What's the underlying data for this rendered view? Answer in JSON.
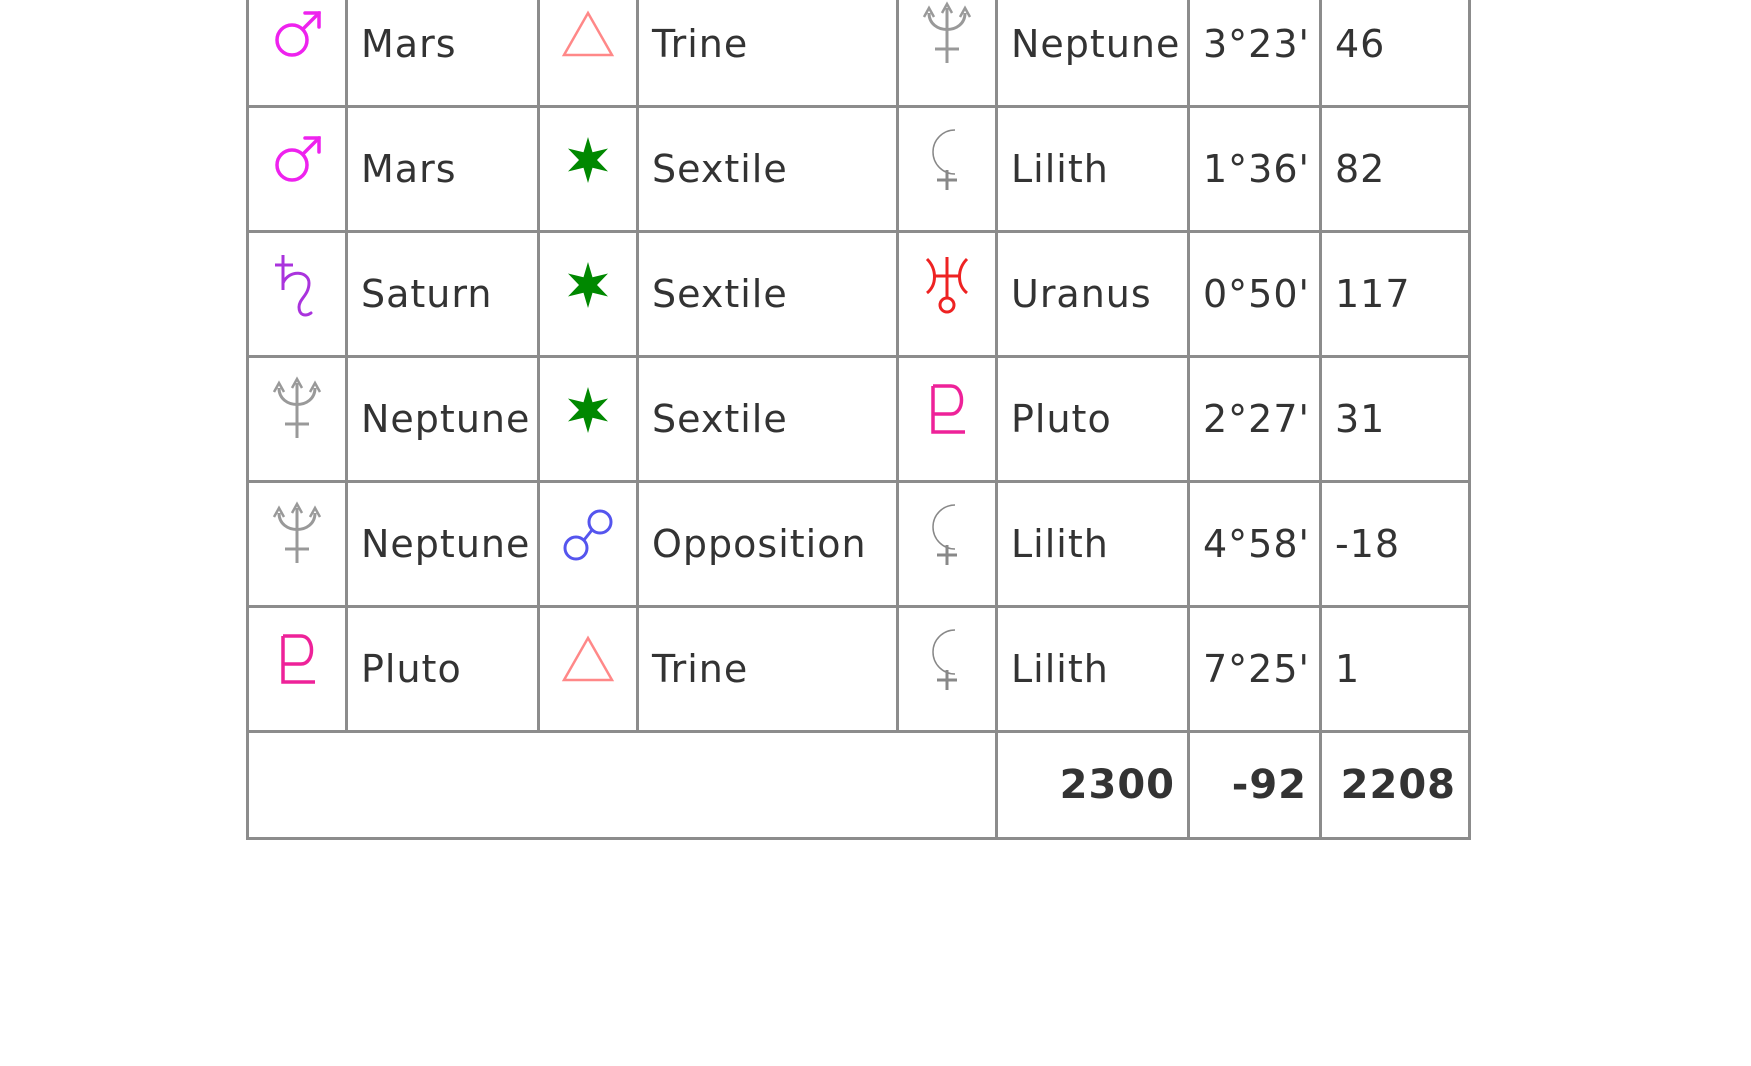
{
  "aspects": [
    {
      "planet1": "Mars",
      "planet1_icon": "mars-icon",
      "aspect": "Trine",
      "aspect_icon": "trine-icon",
      "planet2": "Neptune",
      "planet2_icon": "neptune-icon",
      "orb": "3°23'",
      "value": "46"
    },
    {
      "planet1": "Mars",
      "planet1_icon": "mars-icon",
      "aspect": "Sextile",
      "aspect_icon": "sextile-icon",
      "planet2": "Lilith",
      "planet2_icon": "lilith-icon",
      "orb": "1°36'",
      "value": "82"
    },
    {
      "planet1": "Saturn",
      "planet1_icon": "saturn-icon",
      "aspect": "Sextile",
      "aspect_icon": "sextile-icon",
      "planet2": "Uranus",
      "planet2_icon": "uranus-icon",
      "orb": "0°50'",
      "value": "117"
    },
    {
      "planet1": "Neptune",
      "planet1_icon": "neptune-icon",
      "aspect": "Sextile",
      "aspect_icon": "sextile-icon",
      "planet2": "Pluto",
      "planet2_icon": "pluto-icon",
      "orb": "2°27'",
      "value": "31"
    },
    {
      "planet1": "Neptune",
      "planet1_icon": "neptune-icon",
      "aspect": "Opposition",
      "aspect_icon": "opposition-icon",
      "planet2": "Lilith",
      "planet2_icon": "lilith-icon",
      "orb": "4°58'",
      "value": "-18"
    },
    {
      "planet1": "Pluto",
      "planet1_icon": "pluto-icon",
      "aspect": "Trine",
      "aspect_icon": "trine-icon",
      "planet2": "Lilith",
      "planet2_icon": "lilith-icon",
      "orb": "7°25'",
      "value": "1"
    }
  ],
  "totals": {
    "positive": "2300",
    "negative": "-92",
    "net": "2208"
  },
  "colors": {
    "mars": "#ee22ee",
    "saturn": "#aa33dd",
    "neptune": "#999999",
    "pluto": "#ee2299",
    "uranus": "#ee2222",
    "lilith": "#888888",
    "trine": "#ff8888",
    "sextile": "#008800",
    "opposition": "#5555ee",
    "border": "#8c8c8c",
    "text": "#333333"
  }
}
